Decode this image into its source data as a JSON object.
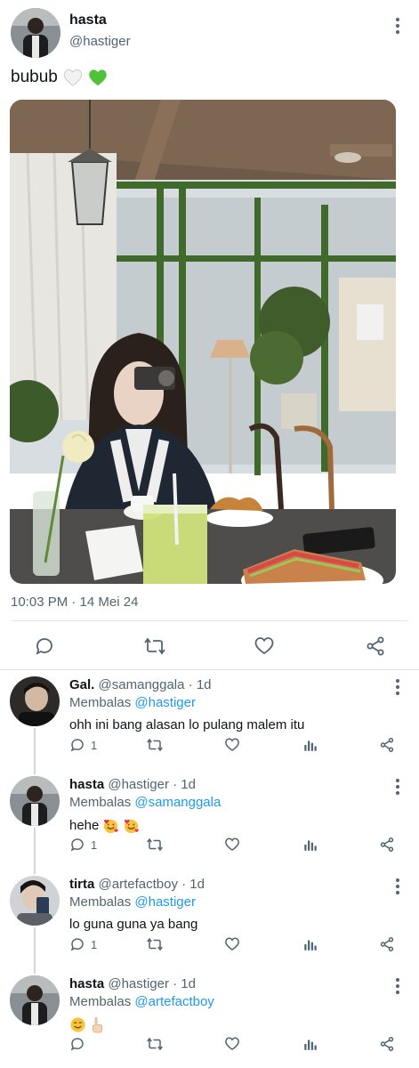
{
  "main_tweet": {
    "author_name": "hasta",
    "author_handle": "@hastiger",
    "text": "bubub",
    "timestamp": "10:03 PM · 14 Mei 24"
  },
  "replies": [
    {
      "name": "Gal.",
      "handle": "@samanggala",
      "time": "· 1d",
      "replying_prefix": "Membalas",
      "replying_to": "@hastiger",
      "text": "ohh ini bang alasan lo pulang malem itu",
      "reply_count": "1"
    },
    {
      "name": "hasta",
      "handle": "@hastiger",
      "time": "· 1d",
      "replying_prefix": "Membalas",
      "replying_to": "@samanggala",
      "text": "hehe",
      "reply_count": "1"
    },
    {
      "name": "tirta",
      "handle": "@artefactboy",
      "time": "· 1d",
      "replying_prefix": "Membalas",
      "replying_to": "@hastiger",
      "text": "lo guna guna ya bang",
      "reply_count": "1"
    },
    {
      "name": "hasta",
      "handle": "@hastiger",
      "time": "· 1d",
      "replying_prefix": "Membalas",
      "replying_to": "@artefactboy",
      "text": "",
      "reply_count": ""
    }
  ],
  "icons": {
    "reply": "reply-icon",
    "retweet": "retweet-icon",
    "like": "heart-icon",
    "share": "share-icon",
    "views": "views-icon",
    "more": "more-icon"
  },
  "colors": {
    "link": "#1d9bf0",
    "secondary_text": "#536471",
    "primary_text": "#0f1419"
  }
}
